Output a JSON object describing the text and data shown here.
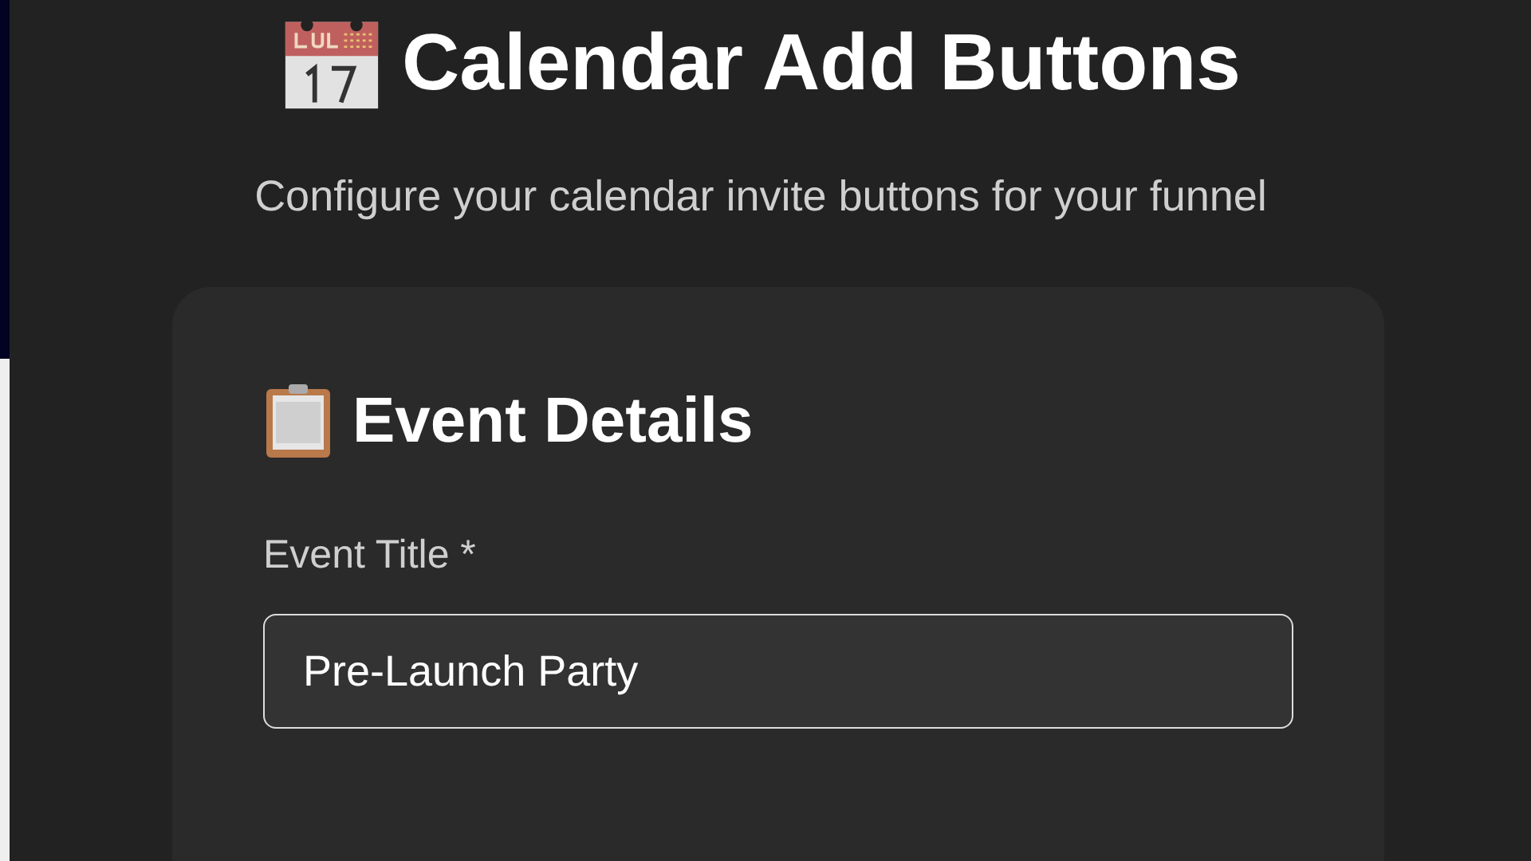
{
  "header": {
    "title": "Calendar Add Buttons",
    "subtitle": "Configure your calendar invite buttons for your funnel"
  },
  "card": {
    "heading": "Event Details",
    "fields": [
      {
        "label": "Event Title *",
        "value": "Pre-Launch Party"
      }
    ]
  }
}
